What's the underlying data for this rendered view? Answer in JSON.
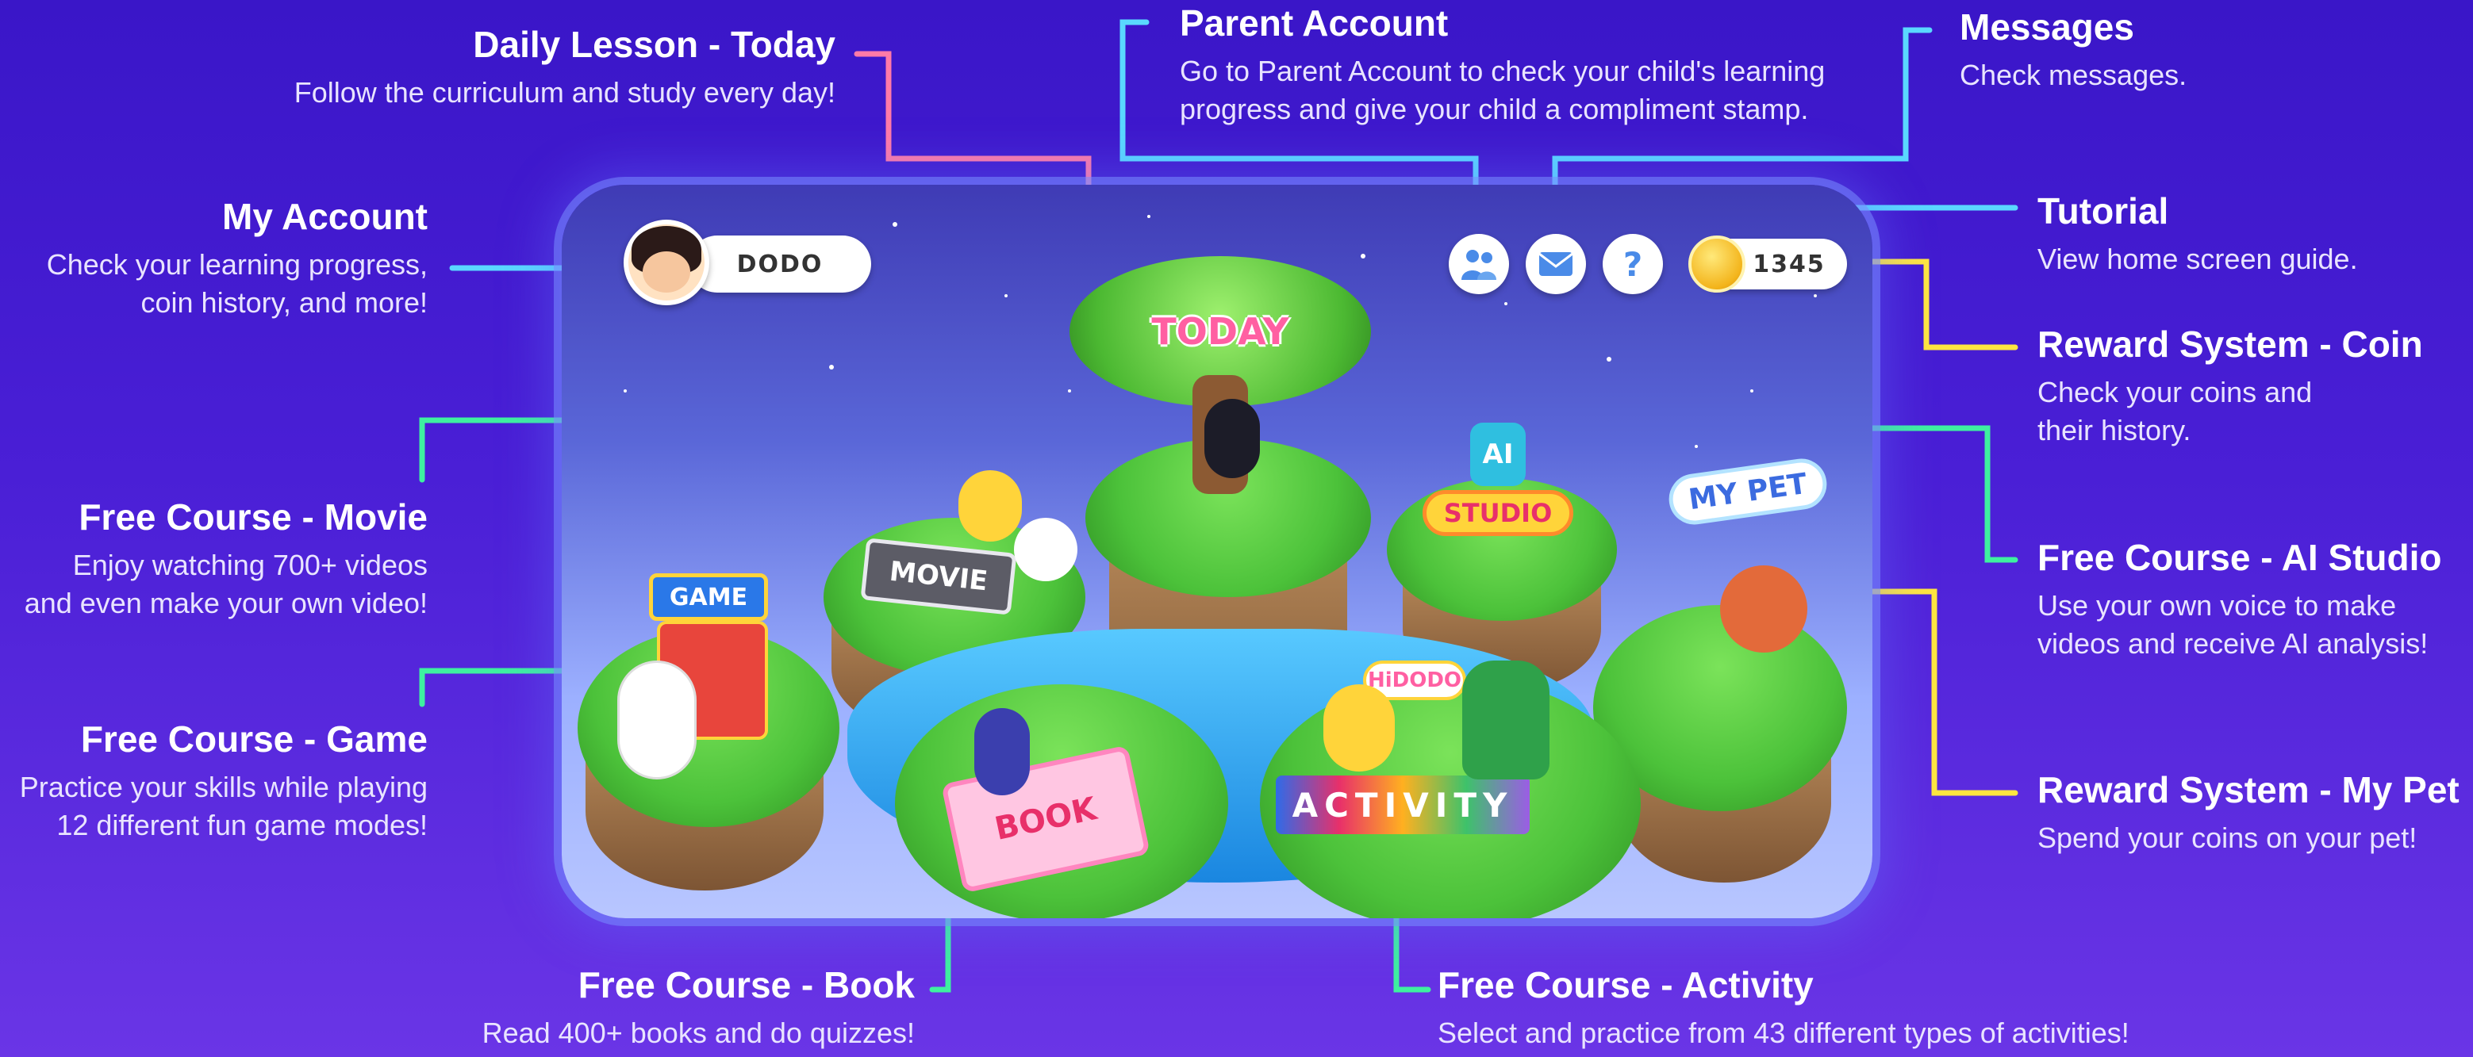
{
  "callouts": {
    "daily_lesson": {
      "title": "Daily Lesson - Today",
      "desc": "Follow the curriculum and study every day!"
    },
    "parent_account": {
      "title": "Parent Account",
      "desc": "Go to Parent Account to check your child's learning\nprogress and give your child a compliment stamp."
    },
    "messages": {
      "title": "Messages",
      "desc": "Check messages."
    },
    "my_account": {
      "title": "My Account",
      "desc": "Check your learning progress,\ncoin history, and more!"
    },
    "tutorial": {
      "title": "Tutorial",
      "desc": "View home screen guide."
    },
    "reward_coin": {
      "title": "Reward System - Coin",
      "desc": "Check your coins and\ntheir history."
    },
    "movie": {
      "title": "Free Course - Movie",
      "desc": "Enjoy watching 700+ videos\nand even make your own video!"
    },
    "ai_studio": {
      "title": "Free Course - AI Studio",
      "desc": "Use your own voice to make\nvideos and receive AI analysis!"
    },
    "game": {
      "title": "Free Course - Game",
      "desc": "Practice your skills while playing\n12 different fun game modes!"
    },
    "reward_pet": {
      "title": "Reward System - My Pet",
      "desc": "Spend your coins on your pet!"
    },
    "book": {
      "title": "Free Course - Book",
      "desc": "Read 400+ books and do quizzes!"
    },
    "activity": {
      "title": "Free Course - Activity",
      "desc": "Select and practice from 43 different types of activities!"
    }
  },
  "screen": {
    "username": "DODO",
    "coin_count": "1345",
    "tutorial_glyph": "?",
    "signs": {
      "today": "TODAY",
      "movie": "MOVIE",
      "game": "GAME",
      "studio": "STUDIO",
      "ai": "AI",
      "my_pet": "MY PET",
      "book": "BOOK",
      "activity": "ACTIVITY",
      "logo": "HiDODO"
    }
  },
  "icons": {
    "parent_account": "family-icon",
    "messages": "envelope-icon",
    "tutorial": "question-icon",
    "coin": "coin-icon"
  },
  "colors": {
    "background": "#4a1fd6",
    "line_blue": "#5ad8ff",
    "line_green": "#3ef0a0",
    "line_yellow": "#ffe640",
    "line_pink": "#ff7aa8"
  }
}
